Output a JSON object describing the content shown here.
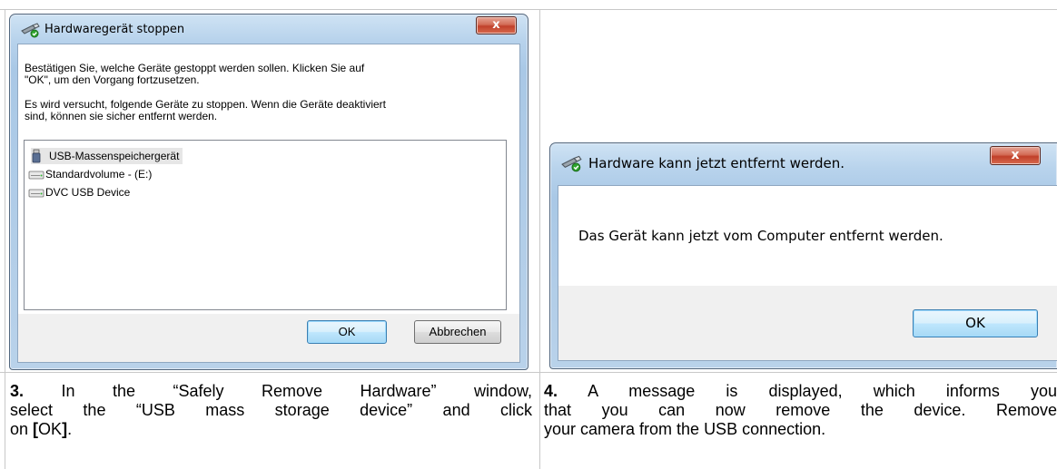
{
  "dialog_stop": {
    "title": "Hardwaregerät stoppen",
    "close_label": "x",
    "message1_line1": "Bestätigen Sie, welche Geräte gestoppt werden sollen. Klicken Sie auf",
    "message1_line2": "\"OK\", um den Vorgang fortzusetzen.",
    "message2_line1": "Es wird versucht, folgende Geräte zu stoppen. Wenn die Geräte deaktiviert",
    "message2_line2": "sind, können sie sicher entfernt werden.",
    "devices": [
      {
        "label": "USB-Massenspeichergerät",
        "icon": "usb-stick-icon",
        "selected": true
      },
      {
        "label": "Standardvolume - (E:)",
        "icon": "drive-icon",
        "selected": false
      },
      {
        "label": "DVC USB Device",
        "icon": "drive-icon",
        "selected": false
      }
    ],
    "ok_label": "OK",
    "cancel_label": "Abbrechen"
  },
  "dialog_removed": {
    "title": "Hardware kann jetzt entfernt werden.",
    "close_label": "x",
    "message": "Das Gerät kann jetzt vom Computer entfernt werden.",
    "ok_label": "OK"
  },
  "captions": {
    "step3_number": "3.",
    "step3_line1": "In the “Safely Remove Hardware” window,",
    "step3_line2": "select the “USB mass storage device” and click",
    "step3_line3_pre": "on",
    "step3_bracket_open": "[",
    "step3_ok": "OK",
    "step3_bracket_close": "]",
    "step3_period": ".",
    "step4_number": "4.",
    "step4_line1": "A message is displayed, which informs you",
    "step4_line2": "that you can now remove the device. Remove",
    "step4_line3": "your camera from the USB connection."
  },
  "colors": {
    "frame": "#b8d3ec",
    "close_red": "#c0402a",
    "ok_default_border": "#3c7fb1"
  }
}
